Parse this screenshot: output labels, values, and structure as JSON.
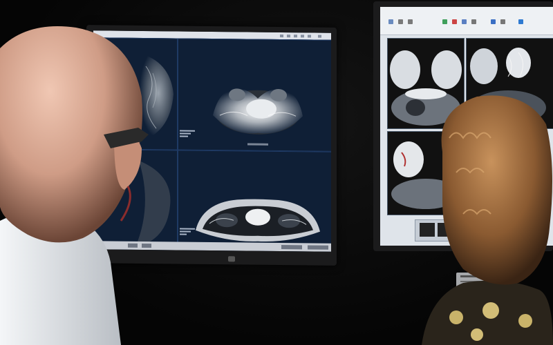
{
  "scene": {
    "description_colors": {
      "background": "#070707",
      "left_screen": "#0a1321",
      "right_screen": "#dfe4ea",
      "skin": "#d8a48e",
      "shirt": "#e9ecef",
      "hair": "#a06b3b"
    },
    "icons": [
      "bald-man-figure",
      "curly-haired-woman-figure",
      "mri-scan-image",
      "monitor"
    ]
  }
}
